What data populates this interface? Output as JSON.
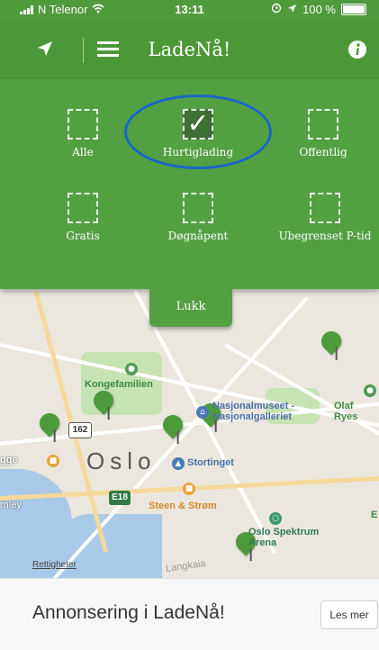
{
  "status_bar": {
    "carrier": "N Telenor",
    "time": "13:11",
    "battery": "100 %"
  },
  "nav": {
    "title": "LadeNå!",
    "icons": [
      "location-arrow-icon",
      "menu-icon",
      "info-icon"
    ]
  },
  "filters": {
    "options": [
      {
        "label": "Alle",
        "checked": false
      },
      {
        "label": "Hurtiglading",
        "checked": true
      },
      {
        "label": "Offentlig",
        "checked": false
      },
      {
        "label": "Gratis",
        "checked": false
      },
      {
        "label": "Døgnåpent",
        "checked": false
      },
      {
        "label": "Ubegrenset P-tid",
        "checked": false
      }
    ],
    "check_glyph": "✓",
    "close_label": "Lukk",
    "highlight_color": "#1a66c8"
  },
  "map": {
    "labels": {
      "kongefamilien": "Kongefamilien",
      "nasjonalmuseet": "Nasjonalmuseet - Nasjonalgalleriet",
      "olaf_ryes": "Olaf Ryes",
      "oslo": "Oslo",
      "stortinget": "Stortinget",
      "steen": "Steen & Strøm",
      "spektrum": "Oslo Spektrum Arena",
      "road_162": "162",
      "road_e18": "E18",
      "langkaia": "Langkaia",
      "gge": "gge",
      "rnley": "rnley",
      "e": "E"
    },
    "legal": "Rettigheter"
  },
  "ad": {
    "text": "Annonsering i LadeNå!",
    "button": "Les mer"
  },
  "colors": {
    "green": "#4c9838",
    "panel": "#53a043",
    "pin": "#4d9a3a"
  }
}
